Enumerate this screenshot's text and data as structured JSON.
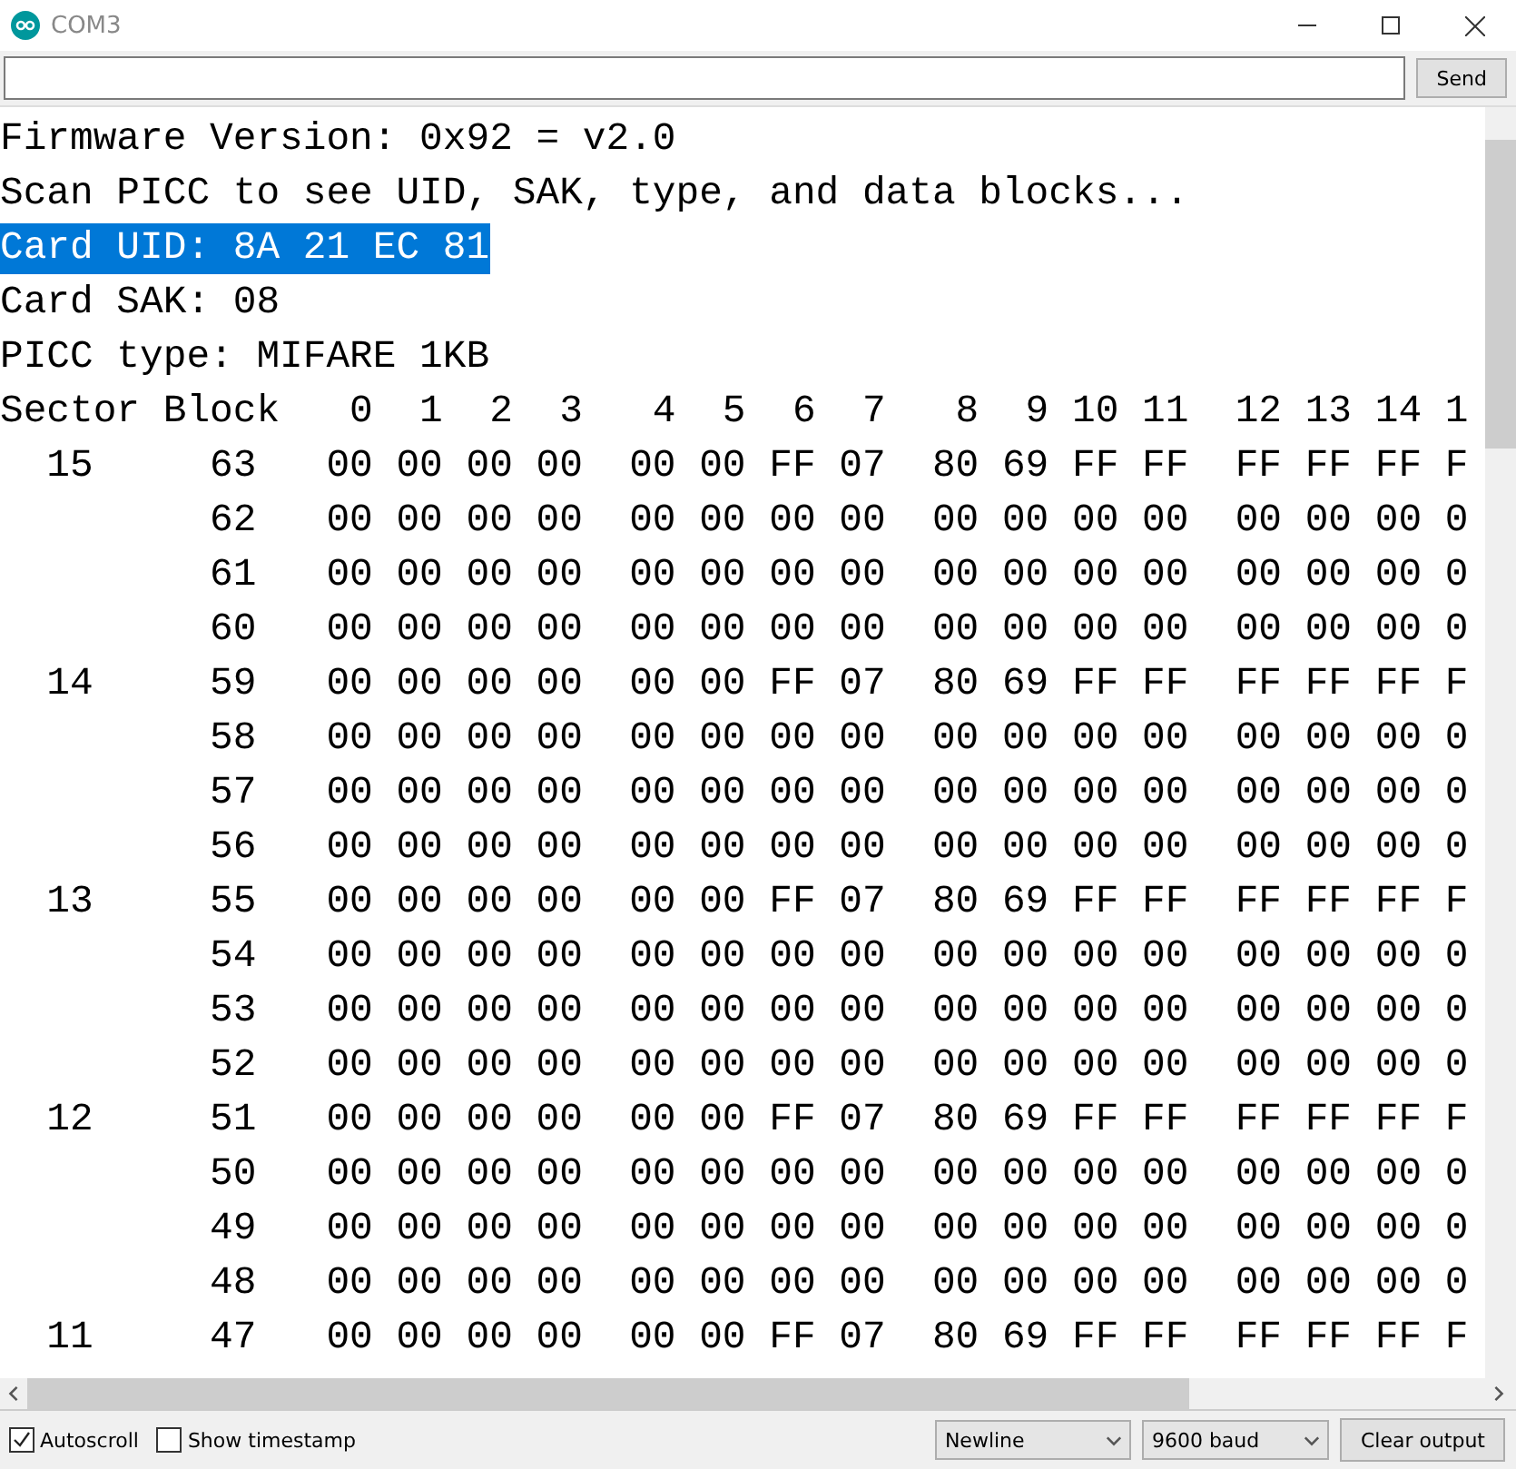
{
  "window": {
    "title": "COM3"
  },
  "send_bar": {
    "button": "Send"
  },
  "output": {
    "lines": [
      {
        "text": "Firmware Version: 0x92 = v2.0",
        "selected": false
      },
      {
        "text": "Scan PICC to see UID, SAK, type, and data blocks...",
        "selected": false
      },
      {
        "text": "Card UID: 8A 21 EC 81",
        "selected": true
      },
      {
        "text": "Card SAK: 08",
        "selected": false
      },
      {
        "text": "PICC type: MIFARE 1KB",
        "selected": false
      },
      {
        "text": "Sector Block   0  1  2  3   4  5  6  7   8  9 10 11  12 13 14 1",
        "selected": false
      },
      {
        "text": "  15     63   00 00 00 00  00 00 FF 07  80 69 FF FF  FF FF FF F",
        "selected": false
      },
      {
        "text": "         62   00 00 00 00  00 00 00 00  00 00 00 00  00 00 00 0",
        "selected": false
      },
      {
        "text": "         61   00 00 00 00  00 00 00 00  00 00 00 00  00 00 00 0",
        "selected": false
      },
      {
        "text": "         60   00 00 00 00  00 00 00 00  00 00 00 00  00 00 00 0",
        "selected": false
      },
      {
        "text": "  14     59   00 00 00 00  00 00 FF 07  80 69 FF FF  FF FF FF F",
        "selected": false
      },
      {
        "text": "         58   00 00 00 00  00 00 00 00  00 00 00 00  00 00 00 0",
        "selected": false
      },
      {
        "text": "         57   00 00 00 00  00 00 00 00  00 00 00 00  00 00 00 0",
        "selected": false
      },
      {
        "text": "         56   00 00 00 00  00 00 00 00  00 00 00 00  00 00 00 0",
        "selected": false
      },
      {
        "text": "  13     55   00 00 00 00  00 00 FF 07  80 69 FF FF  FF FF FF F",
        "selected": false
      },
      {
        "text": "         54   00 00 00 00  00 00 00 00  00 00 00 00  00 00 00 0",
        "selected": false
      },
      {
        "text": "         53   00 00 00 00  00 00 00 00  00 00 00 00  00 00 00 0",
        "selected": false
      },
      {
        "text": "         52   00 00 00 00  00 00 00 00  00 00 00 00  00 00 00 0",
        "selected": false
      },
      {
        "text": "  12     51   00 00 00 00  00 00 FF 07  80 69 FF FF  FF FF FF F",
        "selected": false
      },
      {
        "text": "         50   00 00 00 00  00 00 00 00  00 00 00 00  00 00 00 0",
        "selected": false
      },
      {
        "text": "         49   00 00 00 00  00 00 00 00  00 00 00 00  00 00 00 0",
        "selected": false
      },
      {
        "text": "         48   00 00 00 00  00 00 00 00  00 00 00 00  00 00 00 0",
        "selected": false
      },
      {
        "text": "  11     47   00 00 00 00  00 00 FF 07  80 69 FF FF  FF FF FF F",
        "selected": false
      }
    ]
  },
  "footer": {
    "autoscroll": {
      "label": "Autoscroll",
      "checked": true
    },
    "timestamp": {
      "label": "Show timestamp",
      "checked": false
    },
    "line_ending": {
      "value": "Newline"
    },
    "baud": {
      "value": "9600 baud"
    },
    "clear_button": "Clear output"
  }
}
